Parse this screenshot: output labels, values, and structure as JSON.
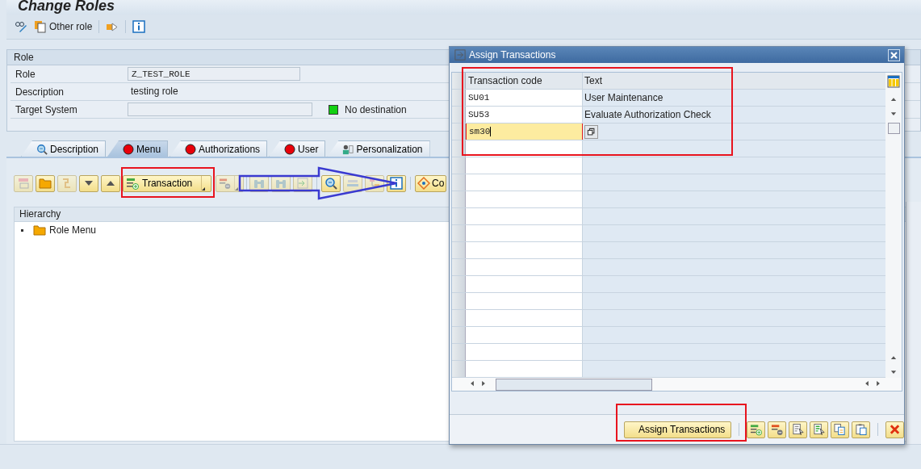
{
  "window": {
    "title": "Change Roles"
  },
  "toolbar": {
    "other_role": "Other role"
  },
  "role_panel": {
    "title": "Role",
    "fields": [
      {
        "label": "Role",
        "value": "Z_TEST_ROLE",
        "kind": "short"
      },
      {
        "label": "Description",
        "value": "testing role",
        "kind": "wide"
      },
      {
        "label": "Target System",
        "kind": "target",
        "status": "No destination"
      }
    ]
  },
  "tabs": [
    {
      "label": "Description",
      "kind": "search",
      "selected": false
    },
    {
      "label": "Menu",
      "kind": "status",
      "selected": true
    },
    {
      "label": "Authorizations",
      "kind": "status",
      "selected": false
    },
    {
      "label": "User",
      "kind": "status",
      "selected": false
    },
    {
      "label": "Personalization",
      "kind": "person",
      "selected": false
    }
  ],
  "menu_toolbar": {
    "transaction_button": "Transaction",
    "cut_button": "Co"
  },
  "hierarchy": {
    "title": "Hierarchy",
    "items": [
      {
        "label": "Role Menu"
      }
    ]
  },
  "dialog": {
    "title": "Assign Transactions",
    "columns": [
      "Transaction code",
      "Text"
    ],
    "rows": [
      {
        "code": "SU01",
        "text": "User Maintenance",
        "editing": false
      },
      {
        "code": "SU53",
        "text": "Evaluate Authorization Check",
        "editing": false
      },
      {
        "code": "sm30",
        "editing": true
      }
    ],
    "assign_button": "Assign Transactions"
  }
}
